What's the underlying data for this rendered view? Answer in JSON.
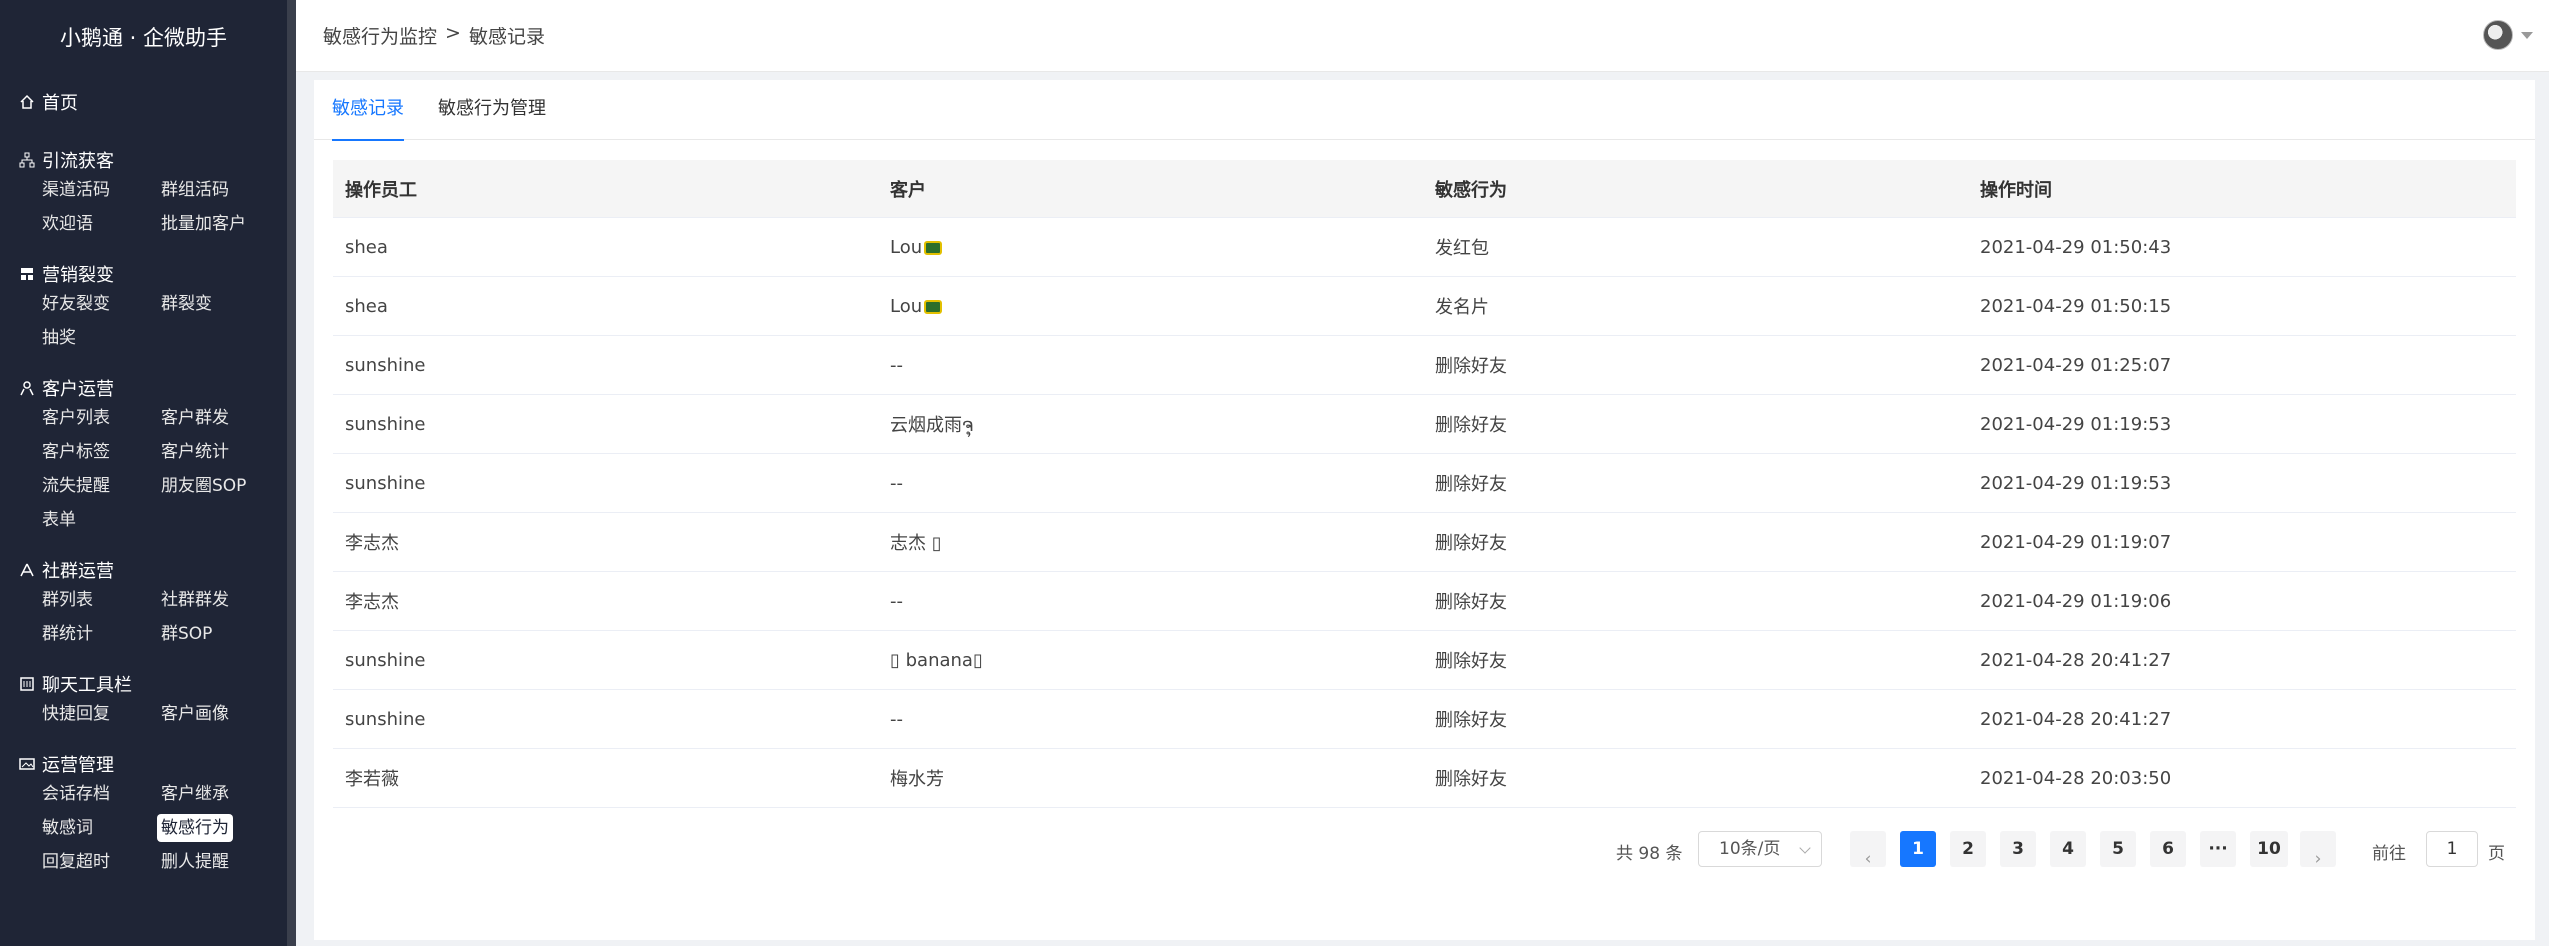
{
  "app": {
    "title": "小鹅通 · 企微助手"
  },
  "sidebar": {
    "home": "首页",
    "groups": [
      {
        "title": "引流获客",
        "items": [
          "渠道活码",
          "群组活码",
          "欢迎语",
          "批量加客户"
        ]
      },
      {
        "title": "营销裂变",
        "items": [
          "好友裂变",
          "群裂变",
          "抽奖"
        ]
      },
      {
        "title": "客户运营",
        "items": [
          "客户列表",
          "客户群发",
          "客户标签",
          "客户统计",
          "流失提醒",
          "朋友圈SOP",
          "表单"
        ]
      },
      {
        "title": "社群运营",
        "items": [
          "群列表",
          "社群群发",
          "群统计",
          "群SOP"
        ]
      },
      {
        "title": "聊天工具栏",
        "items": [
          "快捷回复",
          "客户画像"
        ]
      },
      {
        "title": "运营管理",
        "items": [
          "会话存档",
          "客户继承",
          "敏感词",
          "敏感行为",
          "回复超时",
          "删人提醒"
        ]
      }
    ],
    "active_item": "敏感行为"
  },
  "breadcrumb": {
    "parent": "敏感行为监控",
    "sep": ">",
    "current": "敏感记录"
  },
  "tabs": [
    {
      "label": "敏感记录"
    },
    {
      "label": "敏感行为管理"
    }
  ],
  "table": {
    "headers": [
      "操作员工",
      "客户",
      "敏感行为",
      "操作时间"
    ],
    "rows": [
      [
        "shea",
        "Lou",
        "发红包",
        "2021-04-29 01:50:43"
      ],
      [
        "shea",
        "Lou",
        "发名片",
        "2021-04-29 01:50:15"
      ],
      [
        "sunshine",
        "--",
        "删除好友",
        "2021-04-29 01:25:07"
      ],
      [
        "sunshine",
        "云烟成雨ຈຸ",
        "删除好友",
        "2021-04-29 01:19:53"
      ],
      [
        "sunshine",
        "--",
        "删除好友",
        "2021-04-29 01:19:53"
      ],
      [
        "李志杰",
        "志杰 ▯",
        "删除好友",
        "2021-04-29 01:19:07"
      ],
      [
        "李志杰",
        "--",
        "删除好友",
        "2021-04-29 01:19:06"
      ],
      [
        "sunshine",
        "▯ banana▯",
        "删除好友",
        "2021-04-28 20:41:27"
      ],
      [
        "sunshine",
        "--",
        "删除好友",
        "2021-04-28 20:41:27"
      ],
      [
        "李若薇",
        "梅水芳",
        "删除好友",
        "2021-04-28 20:03:50"
      ]
    ]
  },
  "pagination": {
    "total": "共 98 条",
    "page_size": "10条/页",
    "prev": "‹",
    "pages": [
      "1",
      "2",
      "3",
      "4",
      "5",
      "6",
      "···",
      "10"
    ],
    "next": "›",
    "goto_label": "前往",
    "goto_value": "1",
    "page_unit": "页"
  }
}
